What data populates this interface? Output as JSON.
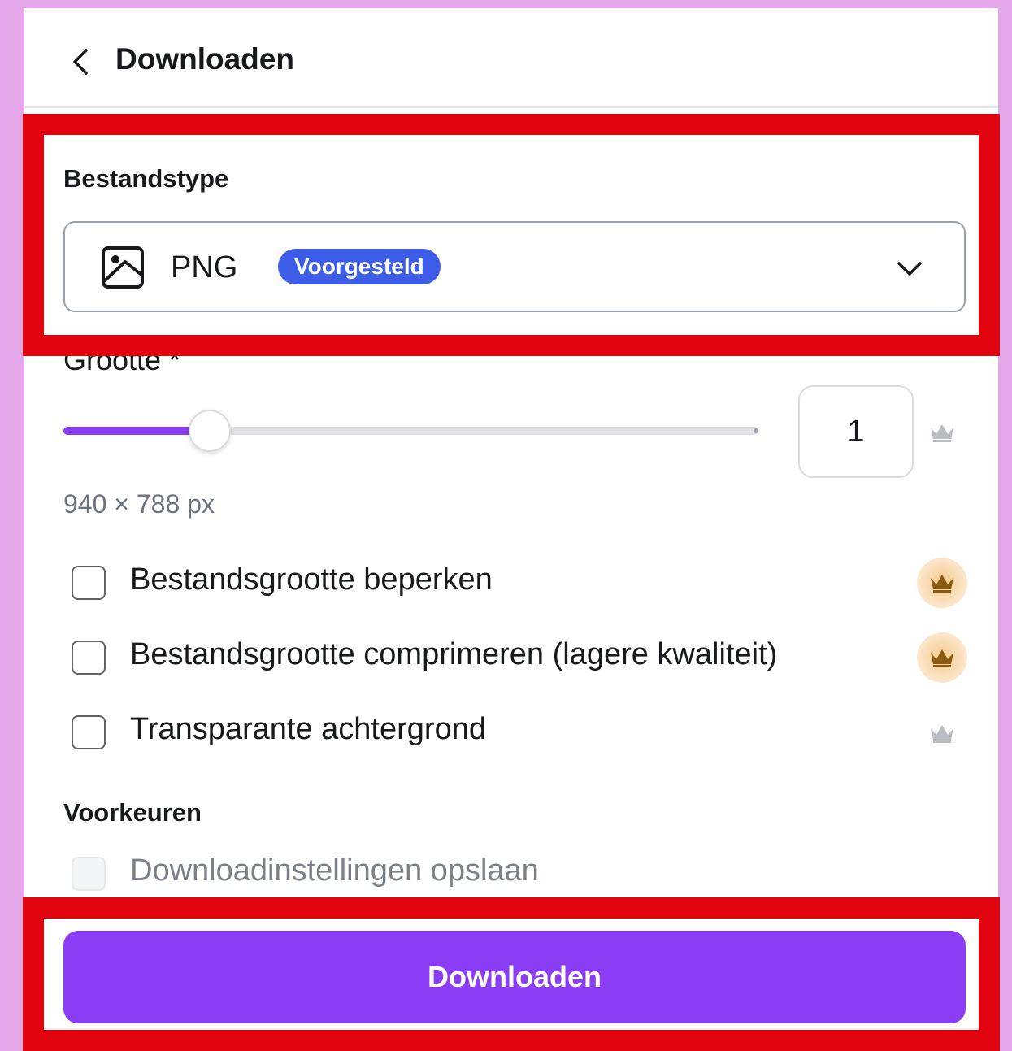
{
  "header": {
    "title": "Downloaden"
  },
  "file_type": {
    "label": "Bestandstype",
    "selected": "PNG",
    "badge": "Voorgesteld",
    "icon": "image-icon"
  },
  "size": {
    "label": "Grootte *",
    "value": "1",
    "slider_fraction": 0.21,
    "dimensions": "940 × 788 px"
  },
  "options": [
    {
      "label": "Bestandsgrootte beperken",
      "checked": false,
      "premium": true
    },
    {
      "label": "Bestandsgrootte comprimeren (lagere kwaliteit)",
      "checked": false,
      "premium": true
    },
    {
      "label": "Transparante achtergrond",
      "checked": false,
      "premium": true
    }
  ],
  "preferences": {
    "label": "Voorkeuren",
    "save_settings": "Downloadinstellingen opslaan"
  },
  "download_button": "Downloaden",
  "colors": {
    "accent": "#8b3cf5",
    "badge": "#3d5ce8",
    "highlight": "#e1040f",
    "page_background": "#e4a7ea"
  }
}
